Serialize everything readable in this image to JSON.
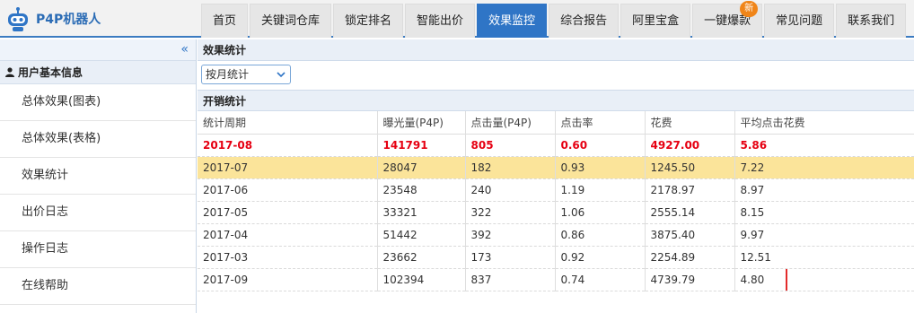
{
  "app": {
    "brand": "P4P机器人"
  },
  "nav": {
    "tabs": [
      {
        "label": "首页",
        "active": false
      },
      {
        "label": "关键词仓库",
        "active": false
      },
      {
        "label": "锁定排名",
        "active": false
      },
      {
        "label": "智能出价",
        "active": false
      },
      {
        "label": "效果监控",
        "active": true
      },
      {
        "label": "综合报告",
        "active": false
      },
      {
        "label": "阿里宝盒",
        "active": false
      },
      {
        "label": "一键爆款",
        "active": false,
        "badge": "新"
      },
      {
        "label": "常见问题",
        "active": false
      },
      {
        "label": "联系我们",
        "active": false
      }
    ]
  },
  "sidebar": {
    "collapse_icon": "«",
    "section_title": "用户基本信息",
    "items": [
      {
        "label": "总体效果(图表)"
      },
      {
        "label": "总体效果(表格)"
      },
      {
        "label": "效果统计"
      },
      {
        "label": "出价日志"
      },
      {
        "label": "操作日志"
      },
      {
        "label": "在线帮助"
      }
    ]
  },
  "main": {
    "panel_title": "效果统计",
    "filter": {
      "selected": "按月统计"
    },
    "table_title": "开销统计",
    "columns": [
      "统计周期",
      "曝光量(P4P)",
      "点击量(P4P)",
      "点击率",
      "花费",
      "平均点击花费"
    ],
    "rows": [
      [
        "2017-08",
        "141791",
        "805",
        "0.60",
        "4927.00",
        "5.86"
      ],
      [
        "2017-07",
        "28047",
        "182",
        "0.93",
        "1245.50",
        "7.22"
      ],
      [
        "2017-06",
        "23548",
        "240",
        "1.19",
        "2178.97",
        "8.97"
      ],
      [
        "2017-05",
        "33321",
        "322",
        "1.06",
        "2555.14",
        "8.15"
      ],
      [
        "2017-04",
        "51442",
        "392",
        "0.86",
        "3875.40",
        "9.97"
      ],
      [
        "2017-03",
        "23662",
        "173",
        "0.92",
        "2254.89",
        "12.51"
      ],
      [
        "2017-09",
        "102394",
        "837",
        "0.74",
        "4739.79",
        "4.80"
      ]
    ]
  },
  "colors": {
    "accent": "#2f75c6",
    "total_row": "#e60012",
    "highlight_row": "#fbe49a",
    "annotation_box": "#e32b2b"
  }
}
